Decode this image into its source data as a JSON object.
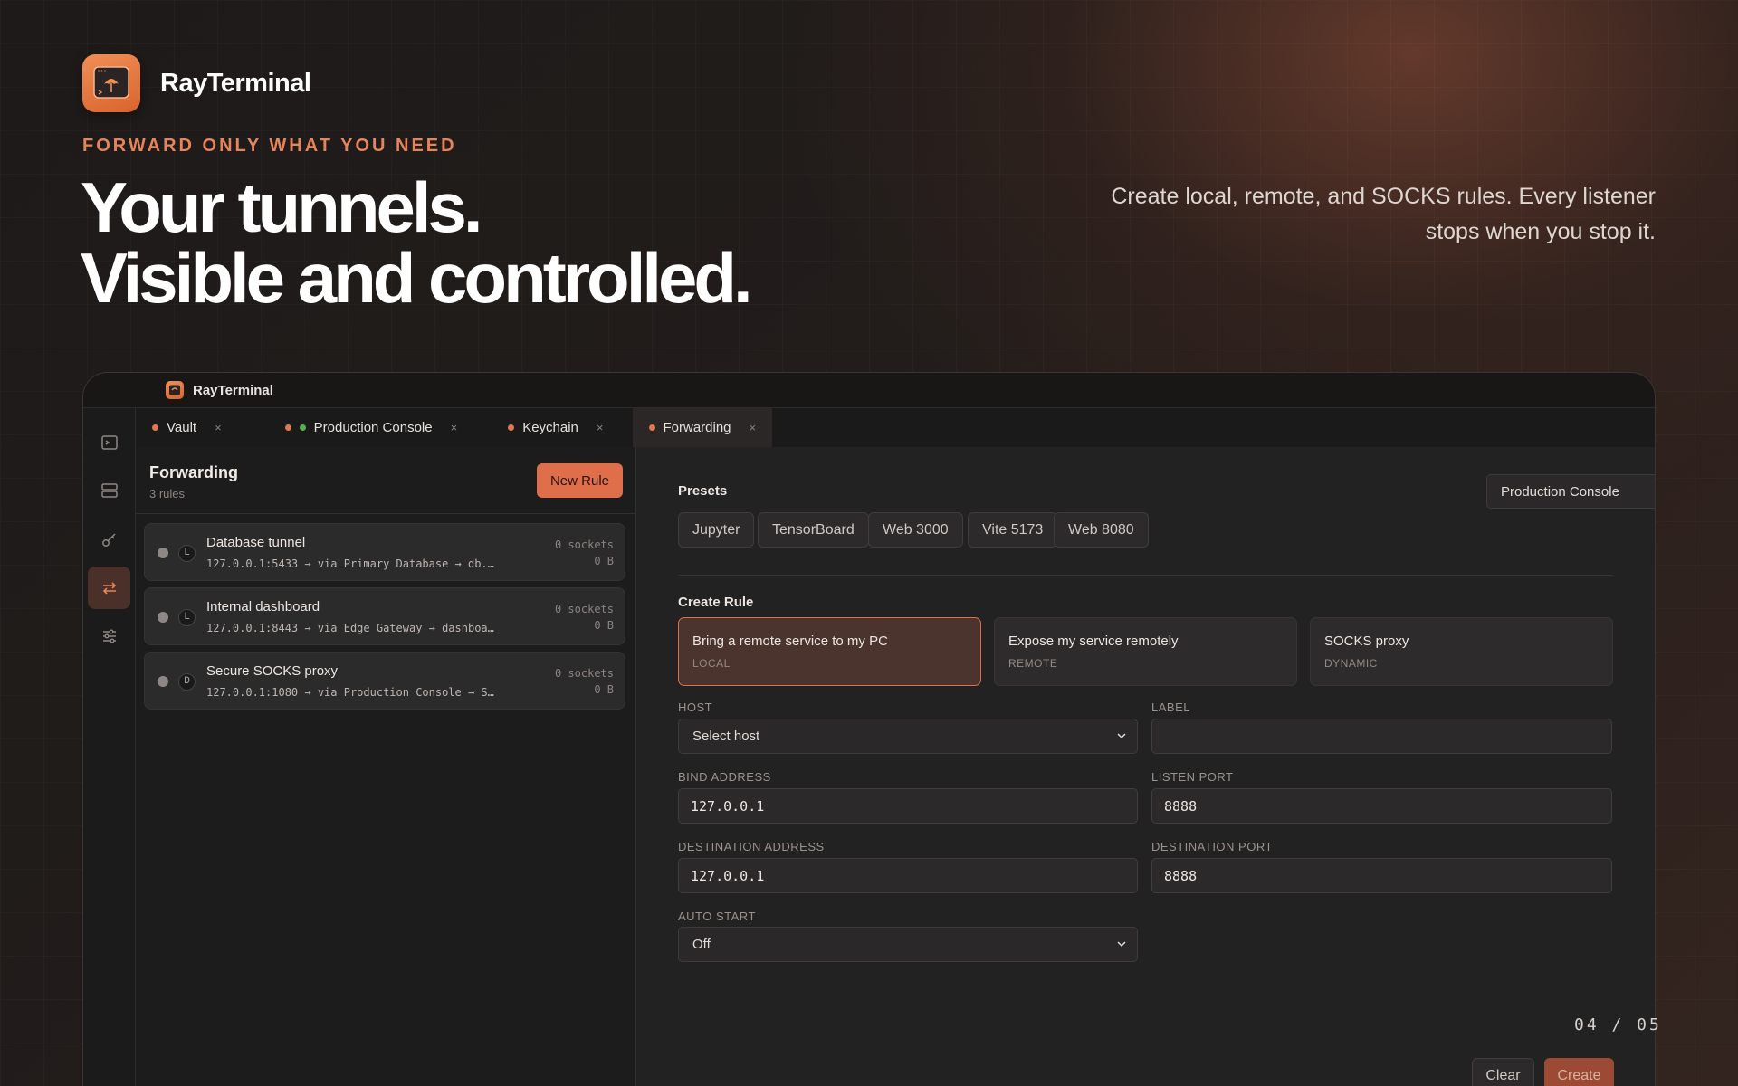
{
  "hero": {
    "brand_name": "RayTerminal",
    "eyebrow": "FORWARD ONLY WHAT YOU NEED",
    "headline_line1": "Your tunnels.",
    "headline_line2": "Visible and controlled.",
    "subcopy_line1": "Create local, remote, and SOCKS rules. Every listener",
    "subcopy_line2": "stops when you stop it.",
    "pager": "04 / 05"
  },
  "app": {
    "title": "RayTerminal",
    "rail": [
      {
        "icon": "terminal-icon"
      },
      {
        "icon": "server-icon"
      },
      {
        "icon": "key-icon"
      },
      {
        "icon": "forwarding-icon",
        "active": true
      },
      {
        "icon": "sliders-icon"
      }
    ],
    "tabs": [
      {
        "label": "Vault",
        "dots": [
          "#e07850"
        ],
        "close": "×"
      },
      {
        "label": "Production Console",
        "dots": [
          "#e07850",
          "#57b04f"
        ],
        "close": "×"
      },
      {
        "label": "Keychain",
        "dots": [
          "#e07850"
        ],
        "close": "×"
      },
      {
        "label": "Forwarding",
        "dots": [
          "#e07850"
        ],
        "close": "×",
        "active": true
      }
    ],
    "forwarding": {
      "title": "Forwarding",
      "count": "3 rules",
      "new_rule_label": "New Rule",
      "rules": [
        {
          "kind": "L",
          "name": "Database tunnel",
          "route": "127.0.0.1:5433 → via Primary Database → db.…",
          "sockets": "0 sockets",
          "bytes": "0 B"
        },
        {
          "kind": "L",
          "name": "Internal dashboard",
          "route": "127.0.0.1:8443 → via Edge Gateway → dashboa…",
          "sockets": "0 sockets",
          "bytes": "0 B"
        },
        {
          "kind": "D",
          "name": "Secure SOCKS proxy",
          "route": "127.0.0.1:1080 → via Production Console → S…",
          "sockets": "0 sockets",
          "bytes": "0 B"
        }
      ]
    },
    "form": {
      "presets_label": "Presets",
      "host_selector": "Production Console",
      "presets": [
        "Jupyter",
        "TensorBoard",
        "Web 3000",
        "Vite 5173",
        "Web 8080"
      ],
      "create_rule_label": "Create Rule",
      "modes": [
        {
          "title": "Bring a remote service to my PC",
          "sub": "LOCAL",
          "active": true
        },
        {
          "title": "Expose my service remotely",
          "sub": "REMOTE"
        },
        {
          "title": "SOCKS proxy",
          "sub": "DYNAMIC"
        }
      ],
      "host_label": "HOST",
      "host_value": "Select host",
      "label_label": "LABEL",
      "label_value": "",
      "bind_label": "BIND ADDRESS",
      "bind_value": "127.0.0.1",
      "listen_label": "LISTEN PORT",
      "listen_value": "8888",
      "dest_addr_label": "DESTINATION ADDRESS",
      "dest_addr_value": "127.0.0.1",
      "dest_port_label": "DESTINATION PORT",
      "dest_port_value": "8888",
      "autostart_label": "AUTO START",
      "autostart_value": "Off",
      "clear_label": "Clear",
      "create_label": "Create"
    }
  },
  "colors": {
    "accent": "#df6e4b",
    "eyebrow": "#e8845a",
    "status_green": "#57b04f"
  }
}
